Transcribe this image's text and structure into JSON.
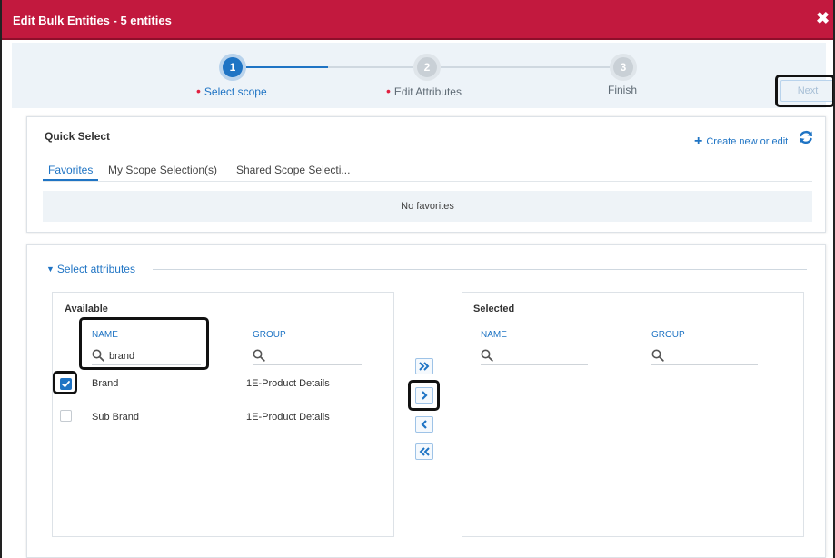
{
  "window": {
    "title": "Edit Bulk Entities - 5 entities",
    "close_glyph": "✖"
  },
  "stepper": {
    "steps": [
      {
        "number": "1",
        "label": "Select scope",
        "state": "active",
        "required": true
      },
      {
        "number": "2",
        "label": "Edit Attributes",
        "state": "inactive",
        "required": true
      },
      {
        "number": "3",
        "label": "Finish",
        "state": "inactive",
        "required": false
      }
    ],
    "required_marker": "•",
    "next_label": "Next"
  },
  "quick_select": {
    "title": "Quick Select",
    "create_label": "Create new or edit",
    "create_icon": "plus-icon",
    "refresh_icon": "refresh-icon",
    "tabs": [
      {
        "label": "Favorites",
        "active": true
      },
      {
        "label": "My Scope Selection(s)",
        "active": false
      },
      {
        "label": "Shared Scope Selecti...",
        "active": false
      }
    ],
    "empty_message": "No favorites"
  },
  "select_attributes": {
    "toggle_label": "Select attributes",
    "toggle_glyph": "▼",
    "available": {
      "title": "Available",
      "columns": {
        "name": "NAME",
        "group": "GROUP"
      },
      "name_search_value": "brand",
      "group_search_value": "",
      "rows": [
        {
          "name": "Brand",
          "group": "1E-Product Details",
          "checked": true
        },
        {
          "name": "Sub Brand",
          "group": "1E-Product Details",
          "checked": false
        }
      ]
    },
    "selected": {
      "title": "Selected",
      "columns": {
        "name": "NAME",
        "group": "GROUP"
      },
      "name_search_value": "",
      "group_search_value": "",
      "rows": []
    },
    "move_buttons": [
      {
        "action": "move-all-right",
        "icon": "double-chevron-right-icon"
      },
      {
        "action": "move-right",
        "icon": "chevron-right-icon"
      },
      {
        "action": "move-left",
        "icon": "chevron-left-icon"
      },
      {
        "action": "move-all-left",
        "icon": "double-chevron-left-icon"
      }
    ]
  },
  "colors": {
    "header": "#c2193e",
    "accent": "#1f74c4",
    "required_dot": "#e02040",
    "stepper_bg": "#edf3f8"
  }
}
